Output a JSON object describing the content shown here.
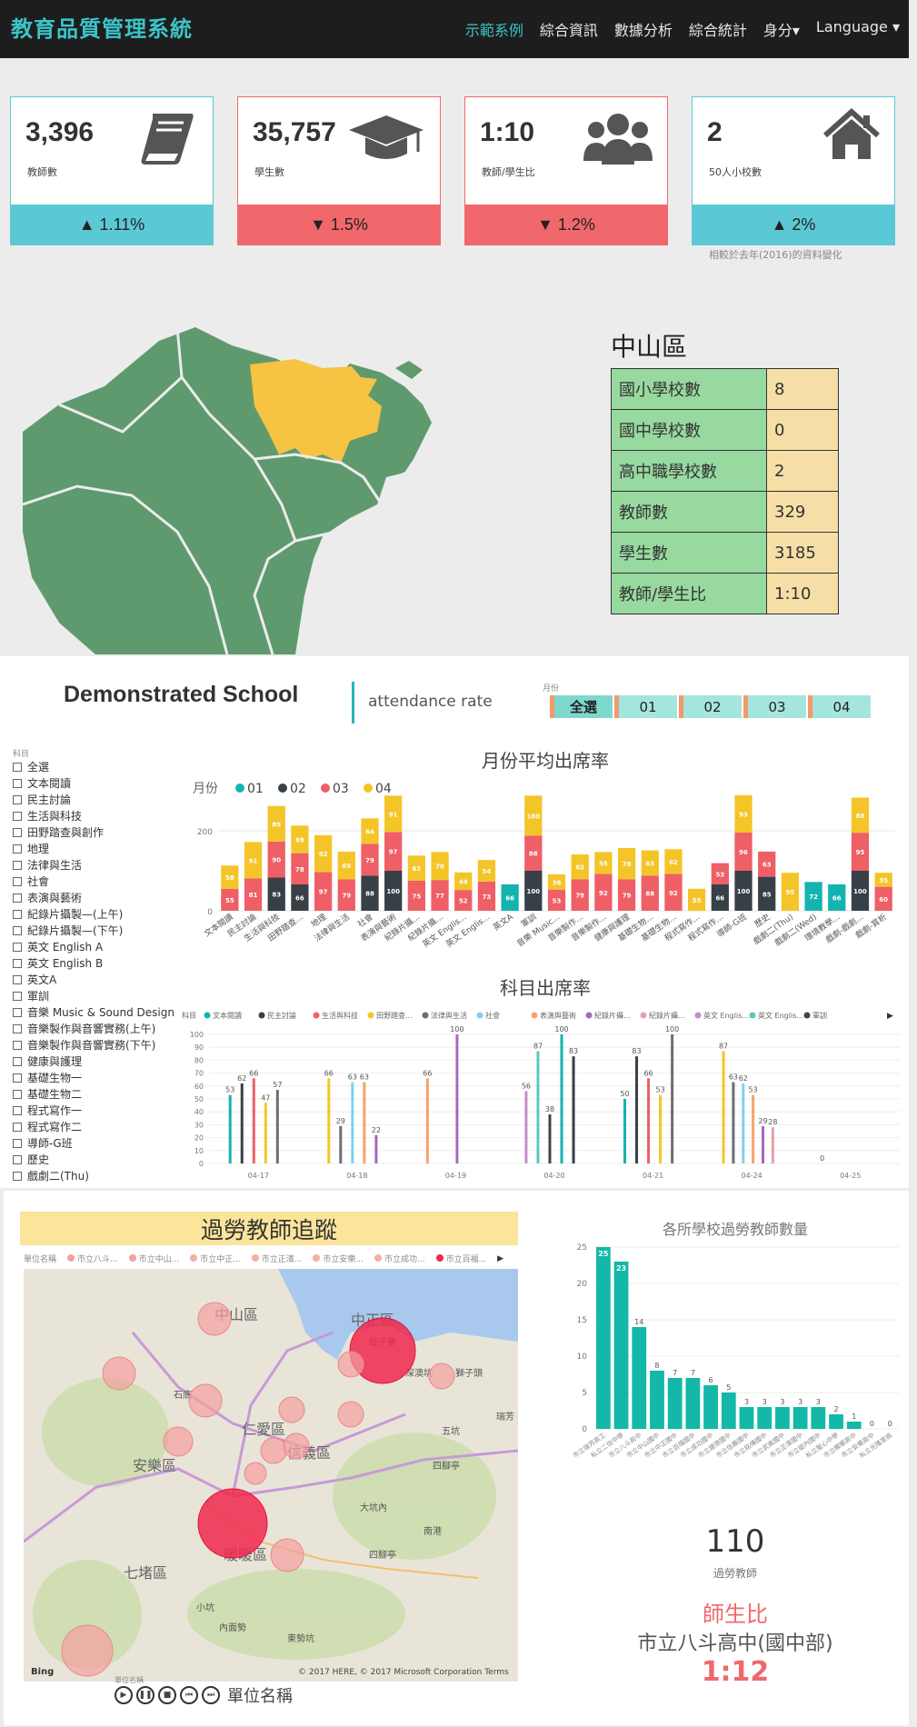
{
  "nav": {
    "brand": "教育品質管理系統",
    "links": [
      "示範系例",
      "綜合資訊",
      "數據分析",
      "綜合統計",
      "身分▾",
      "Language ▾"
    ]
  },
  "kpis": [
    {
      "value": "3,396",
      "label": "教師數",
      "change": "▲ 1.11%",
      "direction": "up",
      "icon": "book-icon"
    },
    {
      "value": "35,757",
      "label": "學生數",
      "change": "▼ 1.5%",
      "direction": "down",
      "icon": "graduation-cap-icon"
    },
    {
      "value": "1:10",
      "label": "教師/學生比",
      "change": "▼ 1.2%",
      "direction": "down",
      "icon": "users-icon"
    },
    {
      "value": "2",
      "label": "50人小校數",
      "change": "▲ 2%",
      "direction": "up",
      "icon": "home-icon"
    }
  ],
  "kpi_note": "相較於去年(2016)的資料變化",
  "district": {
    "name": "中山區",
    "rows": [
      {
        "k": "國小學校數",
        "v": "8"
      },
      {
        "k": "國中學校數",
        "v": "0"
      },
      {
        "k": "高中職學校數",
        "v": "2"
      },
      {
        "k": "教師數",
        "v": "329"
      },
      {
        "k": "學生數",
        "v": "3185"
      },
      {
        "k": "教師/學生比",
        "v": "1:10"
      }
    ]
  },
  "demo": {
    "title": "Demonstrated School",
    "subtitle": "attendance rate",
    "month_label": "月份",
    "month_buttons": [
      "全選",
      "01",
      "02",
      "03",
      "04"
    ],
    "subject_label": "科目",
    "subjects": [
      "全選",
      "文本閱讀",
      "民主討論",
      "生活與科技",
      "田野踏查與創作",
      "地理",
      "法律與生活",
      "社會",
      "表演與藝術",
      "紀錄片攝製—(上午)",
      "紀錄片攝製—(下午)",
      "英文 English A",
      "英文 English B",
      "英文A",
      "軍訓",
      "音樂 Music & Sound Design",
      "音樂製作與音響實務(上午)",
      "音樂製作與音響實務(下午)",
      "健康與護理",
      "基礎生物一",
      "基礎生物二",
      "程式寫作一",
      "程式寫作二",
      "導師-G班",
      "歷史",
      "戲劇二(Thu)"
    ]
  },
  "colors": {
    "c01": "#13b4b0",
    "c02": "#374047",
    "c03": "#ee5f66",
    "c04": "#f4c528",
    "teal": "#13b8a8",
    "bubble": "#f3a0a0",
    "bubble_hot": "#f0294d"
  },
  "chart_data": [
    {
      "type": "bar",
      "title": "月份平均出席率",
      "legend_title": "月份",
      "categories": [
        "文本閱讀",
        "民主討論",
        "生活與科技",
        "田野踏查...",
        "地理",
        "法律與生活",
        "社會",
        "表演與藝術",
        "紀錄片攝...",
        "紀錄片攝...",
        "英文 Englis...",
        "英文 Englis...",
        "英文A",
        "軍訓",
        "音樂 Music...",
        "音樂製作...",
        "音樂製作...",
        "健康與護理",
        "基礎生物...",
        "基礎生物...",
        "程式寫作...",
        "程式寫作...",
        "導師-G班",
        "歷史",
        "戲劇二(Thu)",
        "戲劇二(Wed)",
        "環境教學...",
        "戲劇-戲劇...",
        "戲劇-賞析"
      ],
      "series": [
        {
          "name": "01",
          "values": [
            0,
            0,
            0,
            0,
            0,
            0,
            0,
            0,
            0,
            0,
            0,
            0,
            66,
            0,
            0,
            0,
            0,
            0,
            0,
            0,
            0,
            0,
            0,
            0,
            0,
            72,
            66,
            0,
            0
          ]
        },
        {
          "name": "02",
          "values": [
            0,
            0,
            83,
            66,
            0,
            0,
            88,
            100,
            0,
            0,
            0,
            0,
            0,
            100,
            0,
            0,
            0,
            0,
            0,
            0,
            0,
            66,
            100,
            85,
            0,
            0,
            0,
            100,
            0
          ]
        },
        {
          "name": "03",
          "values": [
            55,
            81,
            90,
            78,
            97,
            79,
            79,
            97,
            75,
            77,
            52,
            73,
            0,
            88,
            53,
            79,
            92,
            79,
            88,
            92,
            0,
            53,
            96,
            63,
            0,
            0,
            0,
            95,
            60
          ]
        },
        {
          "name": "04",
          "values": [
            58,
            91,
            89,
            69,
            92,
            69,
            64,
            91,
            63,
            70,
            44,
            54,
            0,
            100,
            38,
            62,
            55,
            78,
            63,
            62,
            55,
            0,
            93,
            0,
            95,
            0,
            0,
            88,
            35
          ]
        }
      ],
      "ylim": [
        0,
        300
      ],
      "yticks": [
        0,
        200
      ]
    },
    {
      "type": "bar",
      "title": "科目出席率",
      "legend_title": "科目",
      "legend": [
        "文本閱讀",
        "民主討論",
        "生活與科技",
        "田野踏查...",
        "法律與生活",
        "社會",
        "表演與藝術",
        "紀錄片攝...",
        "紀錄片攝...",
        "英文 Englis...",
        "英文 Englis...",
        "軍訓"
      ],
      "categories": [
        "04-17",
        "04-18",
        "04-19",
        "04-20",
        "04-21",
        "04-24",
        "04-25"
      ],
      "ylim": [
        0,
        100
      ],
      "yticks": [
        0,
        10,
        20,
        30,
        40,
        50,
        60,
        70,
        80,
        90,
        100
      ],
      "bars": [
        {
          "x": "04-17",
          "values": [
            53,
            62,
            66,
            47,
            57
          ]
        },
        {
          "x": "04-18",
          "values": [
            66,
            29,
            63,
            63,
            22
          ]
        },
        {
          "x": "04-19",
          "values": [
            66,
            100
          ]
        },
        {
          "x": "04-20",
          "values": [
            56,
            87,
            38,
            100,
            83
          ]
        },
        {
          "x": "04-21",
          "values": [
            50,
            83,
            66,
            53,
            100
          ]
        },
        {
          "x": "04-24",
          "values": [
            87,
            63,
            62,
            53,
            29,
            28
          ]
        },
        {
          "x": "04-25",
          "values": [
            0
          ]
        }
      ]
    },
    {
      "type": "bar",
      "title": "各所學校過勞教師數量",
      "categories": [
        "市立瑞芳高工",
        "私立二信中學",
        "市立八斗高中",
        "市立中山國中",
        "市立中正國中",
        "市立百福國中",
        "市立成功國中",
        "市立建德國中",
        "市立信義國中",
        "市立銘傳國中",
        "市立武崙國中",
        "市立正濱國中",
        "市立碇內國中",
        "私立聖心中學",
        "市立暖暖高中",
        "市立安樂高中",
        "私立光隆家商"
      ],
      "values": [
        25,
        23,
        14,
        8,
        7,
        7,
        6,
        5,
        3,
        3,
        3,
        3,
        3,
        2,
        1,
        0,
        0
      ],
      "ylim": [
        0,
        25
      ],
      "yticks": [
        0,
        5,
        10,
        15,
        20,
        25
      ]
    }
  ],
  "overwork": {
    "title": "過勞教師追蹤",
    "legend_label": "單位名稱",
    "legend_items": [
      "市立八斗...",
      "市立中山...",
      "市立中正...",
      "市立正濱...",
      "市立安樂...",
      "市立成功...",
      "市立百福..."
    ],
    "map_labels": [
      "中山區",
      "中正區",
      "安樂區",
      "信義區",
      "仁愛區",
      "暖暖區",
      "七堵區",
      "碇子寮",
      "五坑",
      "四腳亭",
      "大坑內",
      "南港",
      "小坑",
      "內面勢",
      "東勢坑",
      "瑞芳",
      "石底",
      "獅子頭",
      "深澳坑",
      "四腳亭"
    ],
    "map_credit": "© 2017 HERE, © 2017 Microsoft Corporation  Terms",
    "bing": "Bing",
    "total": "110",
    "total_label": "過勞教師",
    "ratio_label": "師生比",
    "ratio_school": "市立八斗高中(國中部)",
    "ratio_value": "1:12",
    "player_caption": "單位名稱",
    "player_label": "單位名稱"
  }
}
